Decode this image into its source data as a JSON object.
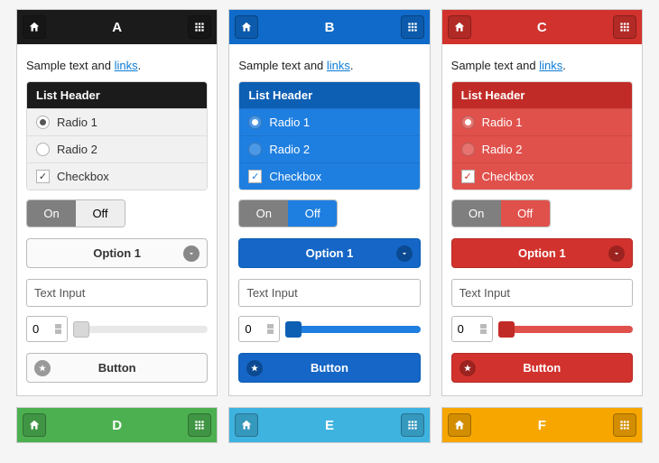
{
  "sample_prefix": "Sample text and ",
  "sample_link": "links",
  "list_header": "List Header",
  "radio1": "Radio 1",
  "radio2": "Radio 2",
  "checkbox": "Checkbox",
  "on": "On",
  "off": "Off",
  "option": "Option 1",
  "text_input": "Text Input",
  "num": "0",
  "button": "Button",
  "titles": {
    "a": "A",
    "b": "B",
    "c": "C",
    "d": "D",
    "e": "E",
    "f": "F"
  }
}
